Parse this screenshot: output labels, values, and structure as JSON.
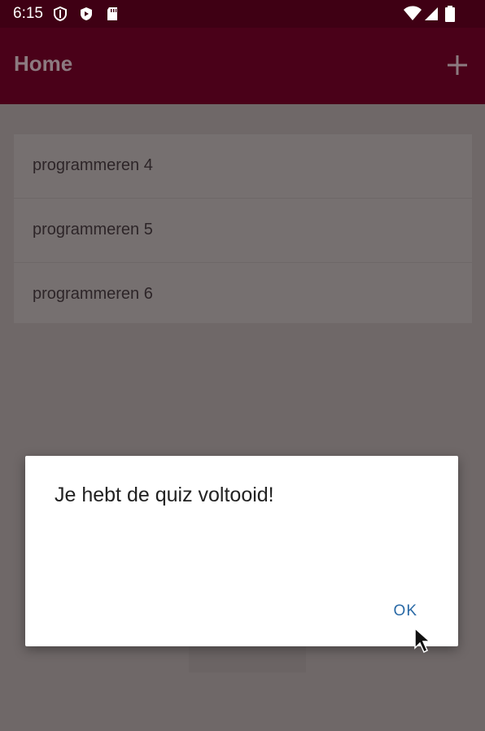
{
  "status_bar": {
    "time": "6:15",
    "icons": [
      "shield-outline-icon",
      "play-shield-icon",
      "sd-card-icon",
      "wifi-icon",
      "signal-icon",
      "battery-icon"
    ]
  },
  "app_bar": {
    "title": "Home",
    "add_icon": "plus-icon"
  },
  "course_list": {
    "items": [
      {
        "label": "programmeren 4"
      },
      {
        "label": "programmeren 5"
      },
      {
        "label": "programmeren 6"
      }
    ]
  },
  "dialog": {
    "message": "Je hebt de quiz voltooid!",
    "ok_label": "OK"
  },
  "colors": {
    "status_bar": "#3f0014",
    "app_bar": "#4a0119",
    "scrim": "#6f6868",
    "dialog_button": "#2a6aa6"
  }
}
